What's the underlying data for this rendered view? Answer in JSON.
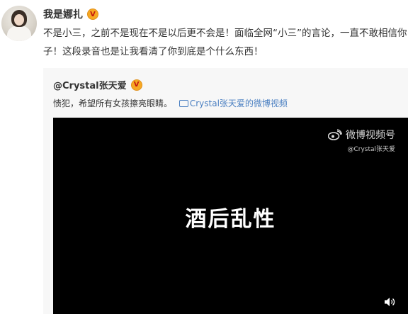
{
  "post": {
    "author": "我是娜扎",
    "verified_badge": "V",
    "text_line1": "不是小三，之前不是现在不是以后更不会是！面临全网“小三”的言论，一直不敢相信你",
    "text_line2": "子！这段录音也是让我看清了你到底是个什么东西！"
  },
  "repost": {
    "author": "@Crystal张天爱",
    "verified_badge": "V",
    "text": "愦犯，希望所有女孩擦亮眼睛。",
    "link_label": "Crystal张天爱的微博视频",
    "video": {
      "watermark_title": "微博视频号",
      "watermark_handle": "@Crystal张天爱",
      "caption": "酒后乱性"
    }
  },
  "colors": {
    "accent_link": "#4a7fc1",
    "badge": "#f7a823",
    "repost_bg": "#f7f7f7"
  },
  "icons": [
    "avatar",
    "verified-badge-icon",
    "video-link-icon",
    "weibo-logo-icon",
    "speaker-icon"
  ]
}
